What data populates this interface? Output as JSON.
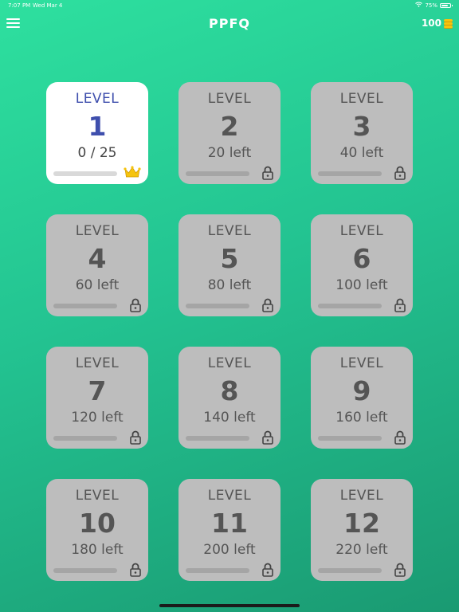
{
  "status_bar": {
    "time": "7:07 PM",
    "date": "Wed Mar 4",
    "battery_text": "75%",
    "battery_level": 0.75
  },
  "header": {
    "title": "PPFQ",
    "menu_icon": "hamburger-menu-icon",
    "coins": "100",
    "coin_icon": "coin-stack-icon"
  },
  "levels": [
    {
      "label": "LEVEL",
      "number": "1",
      "subtitle": "0 / 25",
      "progress": 0.0,
      "status": "unlocked",
      "icon": "crown-icon"
    },
    {
      "label": "LEVEL",
      "number": "2",
      "subtitle": "20 left",
      "progress": 0.0,
      "status": "locked",
      "icon": "lock-icon"
    },
    {
      "label": "LEVEL",
      "number": "3",
      "subtitle": "40 left",
      "progress": 0.0,
      "status": "locked",
      "icon": "lock-icon"
    },
    {
      "label": "LEVEL",
      "number": "4",
      "subtitle": "60 left",
      "progress": 0.0,
      "status": "locked",
      "icon": "lock-icon"
    },
    {
      "label": "LEVEL",
      "number": "5",
      "subtitle": "80 left",
      "progress": 0.0,
      "status": "locked",
      "icon": "lock-icon"
    },
    {
      "label": "LEVEL",
      "number": "6",
      "subtitle": "100 left",
      "progress": 0.0,
      "status": "locked",
      "icon": "lock-icon"
    },
    {
      "label": "LEVEL",
      "number": "7",
      "subtitle": "120 left",
      "progress": 0.0,
      "status": "locked",
      "icon": "lock-icon"
    },
    {
      "label": "LEVEL",
      "number": "8",
      "subtitle": "140 left",
      "progress": 0.0,
      "status": "locked",
      "icon": "lock-icon"
    },
    {
      "label": "LEVEL",
      "number": "9",
      "subtitle": "160 left",
      "progress": 0.0,
      "status": "locked",
      "icon": "lock-icon"
    },
    {
      "label": "LEVEL",
      "number": "10",
      "subtitle": "180 left",
      "progress": 0.0,
      "status": "locked",
      "icon": "lock-icon"
    },
    {
      "label": "LEVEL",
      "number": "11",
      "subtitle": "200 left",
      "progress": 0.0,
      "status": "locked",
      "icon": "lock-icon"
    },
    {
      "label": "LEVEL",
      "number": "12",
      "subtitle": "220 left",
      "progress": 0.0,
      "status": "locked",
      "icon": "lock-icon"
    }
  ],
  "colors": {
    "background_top": "#2ee09f",
    "background_bottom": "#1a9a72",
    "active_card": "#ffffff",
    "locked_card": "#bdbdbd",
    "active_text": "#3f4fad",
    "crown": "#f6c40e"
  }
}
